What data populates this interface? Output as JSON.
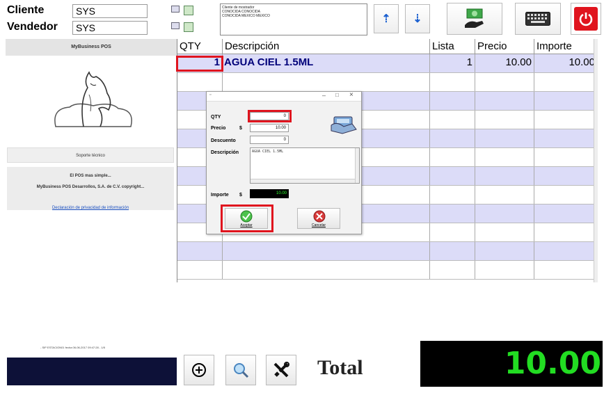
{
  "header": {
    "cliente_label": "Cliente",
    "cliente_value": "SYS",
    "vendedor_label": "Vendedor",
    "vendedor_value": "SYS",
    "info_lines": [
      "Cliente de mostrador",
      "CONOCIDA CONOCIDA",
      "CONOCIDA MEXICO MEXICO"
    ]
  },
  "left_panel": {
    "title": "MyBusiness POS",
    "support": "Soporte técnico",
    "tagline": "El POS mas simple...",
    "copyright": "MyBusiness POS Desarrollos, S.A. de C.V. copyright...",
    "privacy_link": "Declaración de privacidad de información"
  },
  "grid": {
    "headers": [
      "QTY",
      "Descripción",
      "Lista",
      "Precio",
      "Importe"
    ],
    "rows": [
      {
        "qty": "1",
        "descripcion": "AGUA CIEL 1.5ML",
        "lista": "1",
        "precio": "10.00",
        "importe": "10.00"
      }
    ]
  },
  "dialog": {
    "qty_label": "QTY",
    "qty_value": "0",
    "precio_label": "Precio",
    "currency": "$",
    "precio_value": "10.00",
    "descuento_label": "Descuento",
    "descuento_value": "0",
    "descripcion_label": "Descripción",
    "descripcion_value": "AGUA CIEL 1.5ML",
    "importe_label": "Importe",
    "importe_value": "10.00",
    "accept_label": "Aceptar",
    "cancel_label": "Cancelar",
    "title_min": "–",
    "title_max": "□",
    "title_close": "×"
  },
  "footer": {
    "status_text": "- SIP ESTACION01 fecha 06-06-2017 09:47:28 - 1/8",
    "total_label": "Total",
    "total_value": "10.00"
  },
  "colors": {
    "accent_red": "#e0141e",
    "row_alt": "#dcdcf8",
    "total_green": "#22dd22"
  }
}
